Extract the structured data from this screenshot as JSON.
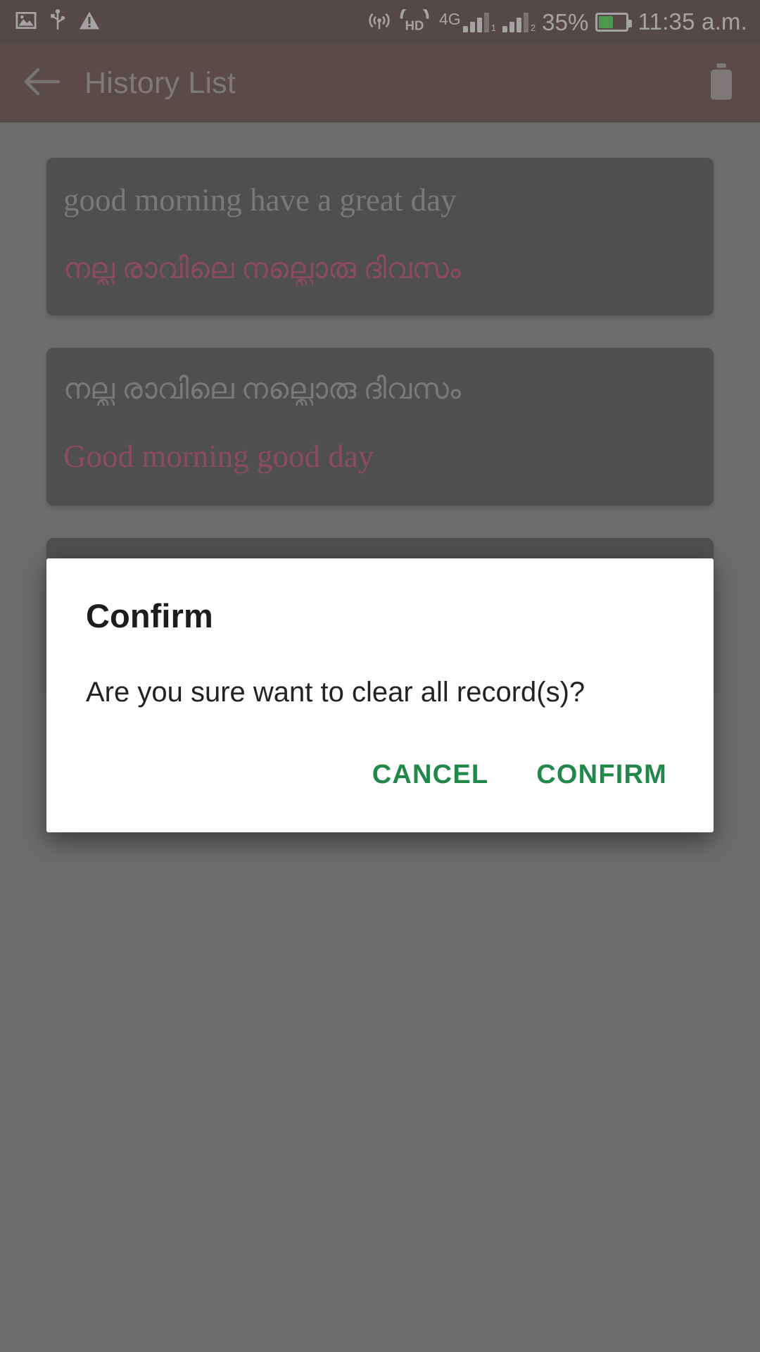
{
  "status_bar": {
    "left_icons": [
      "image-icon",
      "usb-icon",
      "warning-icon"
    ],
    "right_icons": [
      "cast-icon",
      "hd-icon",
      "signal-4g-icon",
      "signal-2-icon",
      "battery-icon"
    ],
    "network_label": "4G",
    "hd_label": "HD",
    "battery_percent": "35%",
    "battery_level": 35,
    "clock": "11:35 a.m."
  },
  "app_bar": {
    "back_icon": "arrow-left-icon",
    "title": "History List",
    "delete_icon": "trash-icon"
  },
  "history": {
    "items": [
      {
        "source": "good morning have a great day",
        "translation": "നല്ല രാവിലെ നല്ലൊരു ദിവസം",
        "source_lang": "en",
        "translation_lang": "ml"
      },
      {
        "source": "നല്ല രാവിലെ നല്ലൊരു ദിവസം",
        "translation": "Good morning good day",
        "source_lang": "ml",
        "translation_lang": "en"
      }
    ]
  },
  "dialog": {
    "title": "Confirm",
    "message": "Are you sure want to clear all record(s)?",
    "cancel_label": "CANCEL",
    "confirm_label": "CONFIRM"
  },
  "colors": {
    "status_bar_bg": "#2d0d07",
    "app_bar_bg": "#3a120b",
    "card_bg": "#1b1b1b",
    "source_text": "#8e8e8e",
    "translation_text": "#c2124c",
    "dialog_action": "#21884a",
    "battery_fill": "#18e018",
    "scrim": "#6e6e6e"
  }
}
